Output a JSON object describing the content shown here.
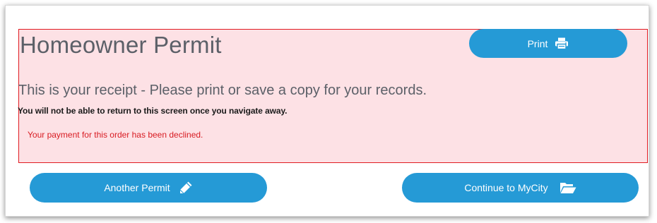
{
  "page": {
    "title": "Homeowner Permit",
    "receipt_text": "This is your receipt - Please print or save a copy for your records.",
    "warning_text": "You will not be able to return to this screen once you navigate away.",
    "error_message": "Your payment for this order has been declined."
  },
  "buttons": {
    "print": {
      "label": "Print",
      "icon": "printer-icon"
    },
    "another_permit": {
      "label": "Another Permit",
      "icon": "pencil-icon"
    },
    "continue": {
      "label": "Continue to MyCity",
      "icon": "folder-open-icon"
    }
  },
  "colors": {
    "button_blue": "#259ad6",
    "alert_background": "#fde1e5",
    "alert_border": "#e01b22",
    "error_text": "#d81b22",
    "title_gray": "#5c6068"
  }
}
